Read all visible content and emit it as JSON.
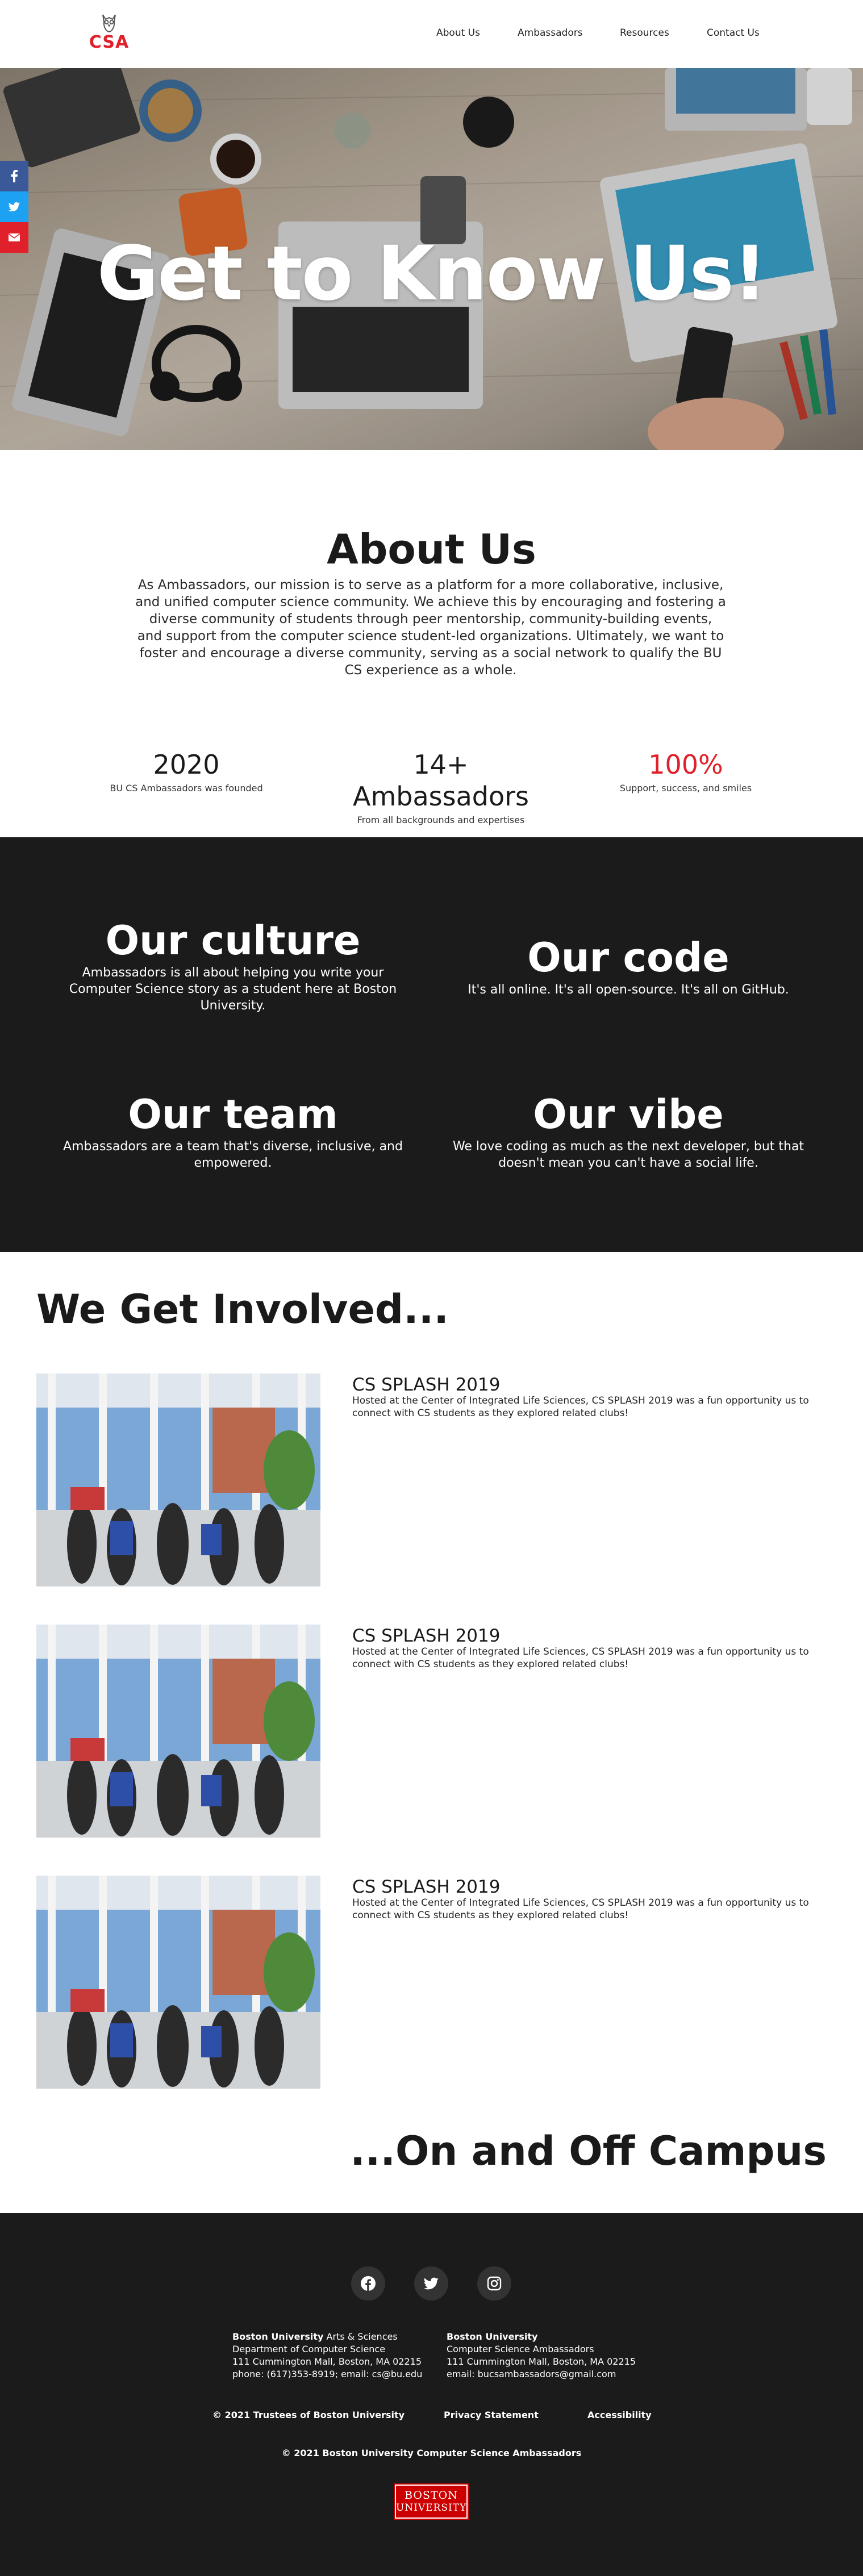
{
  "nav": {
    "logo_text": "CSA",
    "links": [
      "About Us",
      "Ambassadors",
      "Resources",
      "Contact Us"
    ]
  },
  "hero": {
    "title": "Get to Know Us!"
  },
  "share": {
    "icons": [
      "facebook-icon",
      "twitter-icon",
      "email-icon"
    ],
    "colors": [
      "#3b5998",
      "#1da1f2",
      "#e0202a"
    ]
  },
  "about": {
    "title": "About Us",
    "text": "As Ambassadors, our mission is to serve as a platform for a more collaborative, inclusive, and unified computer science community. We achieve this by encouraging and fostering a diverse community of students through peer mentorship, community-building events, and support from the computer science student-led organizations. Ultimately, we want to foster and encourage a diverse community, serving as a social network to qualify the BU CS experience as a whole.",
    "stats": [
      {
        "value": "2020",
        "label": "BU CS Ambassadors was founded"
      },
      {
        "value": "14+ Ambassadors",
        "label": "From all backgrounds and expertises"
      },
      {
        "value": "100%",
        "label": "Support, success, and smiles"
      }
    ]
  },
  "culture": [
    {
      "title": "Our culture",
      "text": "Ambassadors is all about helping you write your Computer Science story as a student here at Boston University."
    },
    {
      "title": "Our code",
      "text": "It's all online. It's all open-source. It's all on GitHub."
    },
    {
      "title": "Our team",
      "text": "Ambassadors are a team that's diverse, inclusive, and empowered."
    },
    {
      "title": "Our vibe",
      "text": "We love coding as much as the next developer, but that doesn't mean you can't have a social life."
    }
  ],
  "involved": {
    "title": "We Get Involved...",
    "events": [
      {
        "title": "CS SPLASH 2019",
        "text": "Hosted at the Center of Integrated Life Sciences, CS SPLASH 2019 was a fun opportunity us to connect with CS students as they explored related clubs!"
      },
      {
        "title": "CS SPLASH 2019",
        "text": "Hosted at the Center of Integrated Life Sciences, CS SPLASH 2019 was a fun opportunity us to connect with CS students as they explored related clubs!"
      },
      {
        "title": "CS SPLASH 2019",
        "text": "Hosted at the Center of Integrated Life Sciences, CS SPLASH 2019 was a fun opportunity us to connect with CS students as they explored related clubs!"
      }
    ],
    "closing": "...On and Off Campus"
  },
  "footer": {
    "social_icons": [
      "facebook-icon",
      "twitter-icon",
      "instagram-icon"
    ],
    "col1": {
      "name_bold": "Boston University",
      "name_rest": " Arts & Sciences",
      "line2": "Department of Computer Science",
      "line3": "111 Cummington Mall, Boston, MA 02215",
      "line4": "phone: (617)353-8919; email: cs@bu.edu"
    },
    "col2": {
      "name_bold": "Boston University",
      "line2": "Computer Science Ambassadors",
      "line3": "111 Cummington Mall, Boston, MA 02215",
      "line4": "email: bucsambassadors@gmail.com"
    },
    "links": [
      "© 2021 Trustees of Boston University",
      "Privacy Statement",
      "Accessibility"
    ],
    "copyright": "© 2021 Boston University Computer Science Ambassadors",
    "bu_logo_line1": "BOSTON",
    "bu_logo_line2": "UNIVERSITY"
  }
}
